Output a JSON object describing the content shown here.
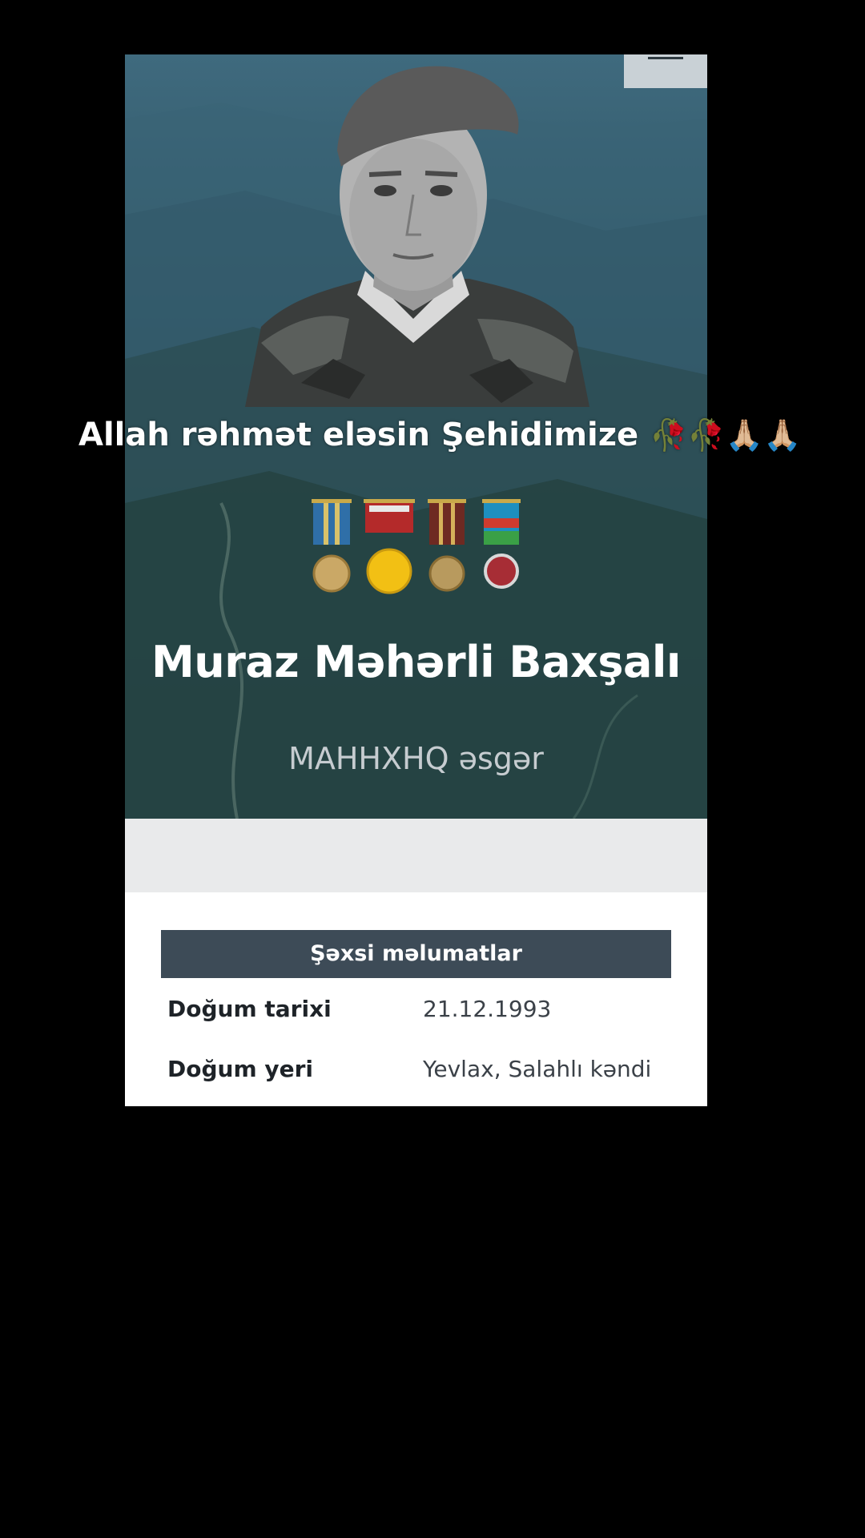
{
  "caption": {
    "text": "Allah rəhmət eləsin Şehidimize",
    "emojis": "🥀🥀🙏🏼🙏🏼"
  },
  "hero": {
    "name": "Muraz Məhərli Baxşalı",
    "rank": "MAHHXHQ əsgər",
    "medals": [
      "medal-1-icon",
      "medal-2-icon",
      "medal-3-icon",
      "medal-4-icon"
    ]
  },
  "personal_info": {
    "header": "Şəxsi məlumatlar",
    "rows": [
      {
        "label": "Doğum tarixi",
        "value": "21.12.1993"
      },
      {
        "label": "Doğum yeri",
        "value": "Yevlax, Salahlı kəndi"
      }
    ]
  },
  "colors": {
    "header_bg": "#3d4b57",
    "hero_top": "#3f6a7e",
    "hero_bottom": "#172f2a"
  }
}
